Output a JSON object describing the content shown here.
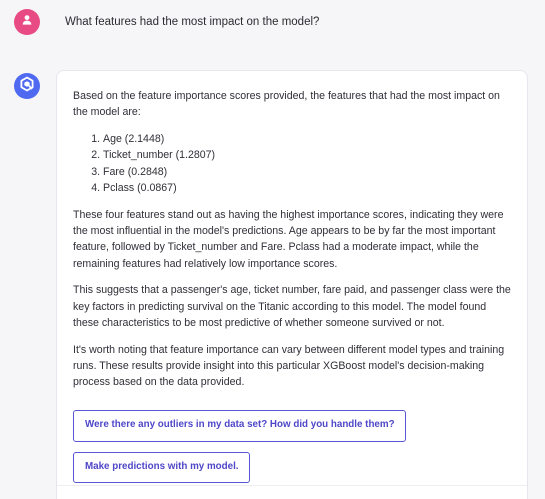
{
  "user_message": {
    "text": "What features had the most impact on the model?",
    "avatar_icon": "user-icon",
    "avatar_color": "#e84a83"
  },
  "assistant_message": {
    "avatar_icon": "assistant-logo-icon",
    "avatar_color": "#4f6af0",
    "intro": "Based on the feature importance scores provided, the features that had the most impact on the model are:",
    "features": [
      "Age (2.1448)",
      "Ticket_number (1.2807)",
      "Fare (0.2848)",
      "Pclass (0.0867)"
    ],
    "paragraphs": [
      "These four features stand out as having the highest importance scores, indicating they were the most influential in the model's predictions. Age appears to be by far the most important feature, followed by Ticket_number and Fare. Pclass had a moderate impact, while the remaining features had relatively low importance scores.",
      "This suggests that a passenger's age, ticket number, fare paid, and passenger class were the key factors in predicting survival on the Titanic according to this model. The model found these characteristics to be most predictive of whether someone survived or not.",
      "It's worth noting that feature importance can vary between different model types and training runs. These results provide insight into this particular XGBoost model's decision-making process based on the data provided."
    ]
  },
  "suggestions": [
    "Were there any outliers in my data set? How did you handle them?",
    "Make predictions with my model."
  ],
  "colors": {
    "accent": "#4f46c8",
    "background": "#f6f6f8"
  }
}
